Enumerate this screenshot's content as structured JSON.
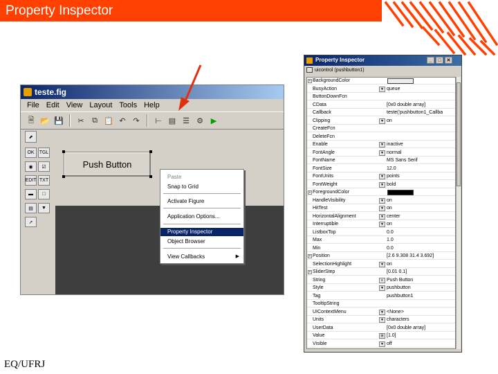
{
  "slide": {
    "title": "Property Inspector",
    "footer": "EQ/UFRJ",
    "accent_color": "#ff4000"
  },
  "guide": {
    "window_title": "teste.fig",
    "menu": [
      "File",
      "Edit",
      "View",
      "Layout",
      "Tools",
      "Help"
    ],
    "push_button_label": "Push Button",
    "palette": [
      "select-arrow-icon",
      "ok-button-icon",
      "slider-icon",
      "radio-icon",
      "checkbox-icon",
      "edit-text-icon",
      "static-text-icon",
      "popup-icon",
      "listbox-icon",
      "listbox2-icon",
      "axes-icon"
    ],
    "palette_labels": {
      "ok": "OK",
      "tgl": "TGL",
      "edit": "EDIT",
      "txt": "TXT"
    }
  },
  "context_menu": {
    "items": [
      {
        "label": "Paste",
        "disabled": true
      },
      {
        "label": "Snap to Grid"
      },
      {
        "label": "Activate Figure"
      },
      {
        "label": "Application Options..."
      },
      {
        "label": "Property Inspector",
        "selected": true
      },
      {
        "label": "Object Browser"
      },
      {
        "label": "View Callbacks",
        "submenu": true
      }
    ]
  },
  "inspector": {
    "title": "Property Inspector",
    "object": "uicontrol (pushbutton1)",
    "properties": [
      {
        "name": "BackgroundColor",
        "value": "",
        "expand": "+",
        "color": "#eeeeee"
      },
      {
        "name": "BusyAction",
        "value": "queue",
        "ctrl": "▼"
      },
      {
        "name": "ButtonDownFcn",
        "value": ""
      },
      {
        "name": "CData",
        "value": "[0x0 double array]"
      },
      {
        "name": "Callback",
        "value": "teste('pushbutton1_Callba"
      },
      {
        "name": "Clipping",
        "value": "on",
        "ctrl": "▼"
      },
      {
        "name": "CreateFcn",
        "value": ""
      },
      {
        "name": "DeleteFcn",
        "value": ""
      },
      {
        "name": "Enable",
        "value": "inactive",
        "ctrl": "▼"
      },
      {
        "name": "FontAngle",
        "value": "normal",
        "ctrl": "▼"
      },
      {
        "name": "FontName",
        "value": "MS Sans Serif"
      },
      {
        "name": "FontSize",
        "value": "12.0"
      },
      {
        "name": "FontUnits",
        "value": "points",
        "ctrl": "▼"
      },
      {
        "name": "FontWeight",
        "value": "bold",
        "ctrl": "▼"
      },
      {
        "name": "ForegroundColor",
        "value": "",
        "expand": "+",
        "color": "#000000"
      },
      {
        "name": "HandleVisibility",
        "value": "on",
        "ctrl": "▼"
      },
      {
        "name": "HitTest",
        "value": "on",
        "ctrl": "▼"
      },
      {
        "name": "HorizontalAlignment",
        "value": "center",
        "ctrl": "▼"
      },
      {
        "name": "Interruptible",
        "value": "on",
        "ctrl": "▼"
      },
      {
        "name": "ListboxTop",
        "value": "0.0"
      },
      {
        "name": "Max",
        "value": "1.0"
      },
      {
        "name": "Min",
        "value": "0.0"
      },
      {
        "name": "Position",
        "value": "[2.6 9.308 31.4 3.692]",
        "expand": "+"
      },
      {
        "name": "SelectionHighlight",
        "value": "on",
        "ctrl": "▼"
      },
      {
        "name": "SliderStep",
        "value": "[0.01 0.1]",
        "expand": "+"
      },
      {
        "name": "String",
        "value": "Push Button",
        "ctrl": "≡"
      },
      {
        "name": "Style",
        "value": "pushbutton",
        "ctrl": "▼"
      },
      {
        "name": "Tag",
        "value": "pushbutton1"
      },
      {
        "name": "TooltipString",
        "value": ""
      },
      {
        "name": "UIContextMenu",
        "value": "<None>",
        "ctrl": "▼"
      },
      {
        "name": "Units",
        "value": "characters",
        "ctrl": "▼"
      },
      {
        "name": "UserData",
        "value": "[0x0 double array]"
      },
      {
        "name": "Value",
        "value": "[1.0]",
        "ctrl": "⊞"
      },
      {
        "name": "Visible",
        "value": "off",
        "ctrl": "▼"
      }
    ]
  }
}
